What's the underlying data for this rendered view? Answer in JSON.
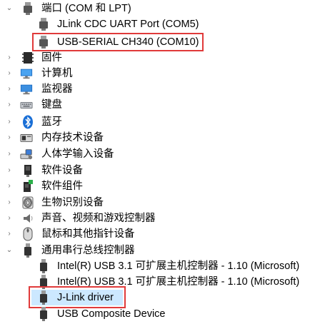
{
  "tree": {
    "items": [
      {
        "label": "端口 (COM 和 LPT)",
        "icon": "port-icon",
        "expanded": true
      },
      {
        "label": "JLink CDC UART Port (COM5)",
        "icon": "port-icon"
      },
      {
        "label": "USB-SERIAL CH340 (COM10)",
        "icon": "port-icon"
      },
      {
        "label": "固件",
        "icon": "firmware-icon"
      },
      {
        "label": "计算机",
        "icon": "computer-icon"
      },
      {
        "label": "监视器",
        "icon": "monitor-icon"
      },
      {
        "label": "键盘",
        "icon": "keyboard-icon"
      },
      {
        "label": "蓝牙",
        "icon": "bluetooth-icon"
      },
      {
        "label": "内存技术设备",
        "icon": "memory-device-icon"
      },
      {
        "label": "人体学输入设备",
        "icon": "hid-icon"
      },
      {
        "label": "软件设备",
        "icon": "software-device-icon"
      },
      {
        "label": "软件组件",
        "icon": "software-component-icon"
      },
      {
        "label": "生物识别设备",
        "icon": "biometric-icon"
      },
      {
        "label": "声音、视频和游戏控制器",
        "icon": "speaker-icon"
      },
      {
        "label": "鼠标和其他指针设备",
        "icon": "mouse-icon"
      },
      {
        "label": "通用串行总线控制器",
        "icon": "usb-icon",
        "expanded": true
      },
      {
        "label": "Intel(R) USB 3.1 可扩展主机控制器 - 1.10 (Microsoft)",
        "icon": "usb-icon"
      },
      {
        "label": "Intel(R) USB 3.1 可扩展主机控制器 - 1.10 (Microsoft)",
        "icon": "usb-icon"
      },
      {
        "label": "J-Link driver",
        "icon": "usb-icon",
        "selected": true
      },
      {
        "label": "USB Composite Device",
        "icon": "usb-icon"
      }
    ]
  },
  "colors": {
    "highlight_border": "#e03a3a",
    "selection": "#cce8ff"
  }
}
